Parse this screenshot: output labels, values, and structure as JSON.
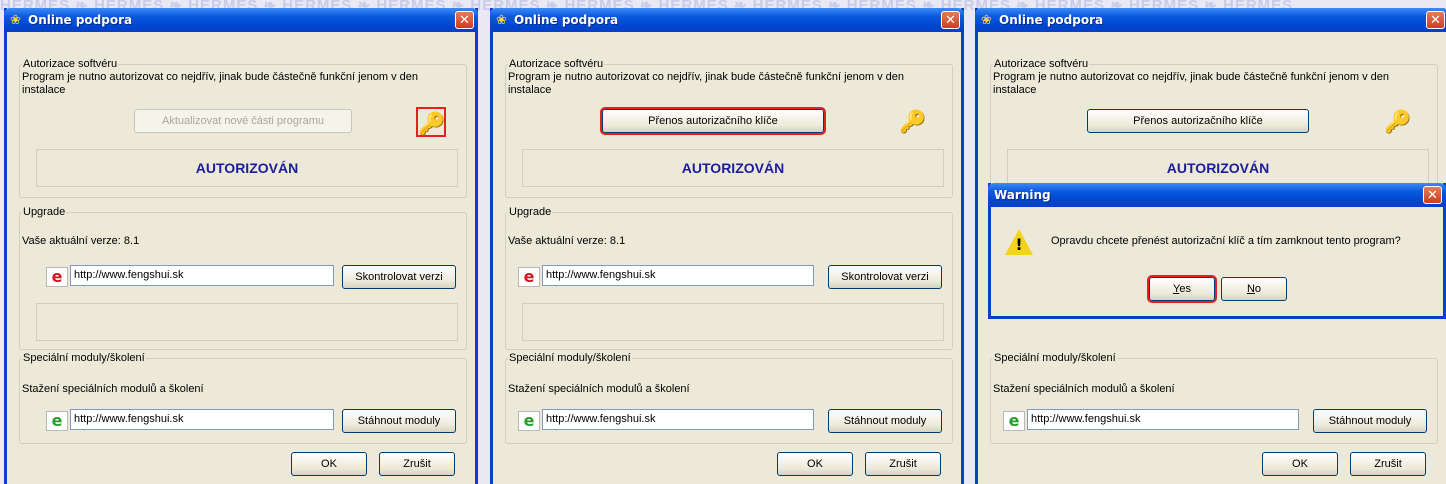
{
  "watermark": "HERMES ❧ HERMES ❧ HERMES ❧ HERMES ❧ HERMES ❧ HERMES ❧ HERMES ❧ HERMES ❧ HERMES ❧ HERMES ❧ HERMES ❧ HERMES ❧ HERMES ❧ HERMES",
  "colors": {
    "titlebar": "#0a5ae0",
    "highlight": "#e52020",
    "status_text": "#1c1c9c"
  },
  "windows": [
    {
      "title": "Online podpora",
      "auth": {
        "legend": "Autorizace softvéru",
        "desc": "Program je nutno autorizovat co nejdřív, jinak bude částečně funkční jenom v den instalace",
        "button": "Aktualizovat nové části programu",
        "status": "AUTORIZOVÁN"
      },
      "upgrade": {
        "legend": "Upgrade",
        "version": "Vaše aktuální verze: 8.1",
        "url": "http://www.fengshui.sk",
        "button": "Skontrolovat verzi"
      },
      "modules": {
        "legend": "Speciální moduly/školení",
        "desc": "Stažení speciálních modulů a školení",
        "url": "http://www.fengshui.sk",
        "button": "Stáhnout moduly"
      },
      "ok": "OK",
      "cancel": "Zrušit"
    },
    {
      "title": "Online podpora",
      "auth": {
        "legend": "Autorizace softvéru",
        "desc": "Program je nutno autorizovat co nejdřív, jinak bude částečně funkční jenom v den instalace",
        "button": "Přenos autorizačního klíče",
        "status": "AUTORIZOVÁN"
      },
      "upgrade": {
        "legend": "Upgrade",
        "version": "Vaše aktuální verze: 8.1",
        "url": "http://www.fengshui.sk",
        "button": "Skontrolovat verzi"
      },
      "modules": {
        "legend": "Speciální moduly/školení",
        "desc": "Stažení speciálních modulů a školení",
        "url": "http://www.fengshui.sk",
        "button": "Stáhnout moduly"
      },
      "ok": "OK",
      "cancel": "Zrušit"
    },
    {
      "title": "Online podpora",
      "auth": {
        "legend": "Autorizace softvéru",
        "desc": "Program je nutno autorizovat co nejdřív, jinak bude částečně funkční jenom v den instalace",
        "button": "Přenos autorizačního klíče",
        "status": "AUTORIZOVÁN"
      },
      "modules": {
        "legend": "Speciální moduly/školení",
        "desc": "Stažení speciálních modulů a školení",
        "url": "http://www.fengshui.sk",
        "button": "Stáhnout moduly"
      },
      "ok": "OK",
      "cancel": "Zrušit"
    }
  ],
  "warning": {
    "title": "Warning",
    "message": "Opravdu chcete přenést autorizační klíč a tím zamknout tento program?",
    "yes_mnemonic": "Y",
    "yes_rest": "es",
    "no_mnemonic": "N",
    "no_rest": "o"
  }
}
